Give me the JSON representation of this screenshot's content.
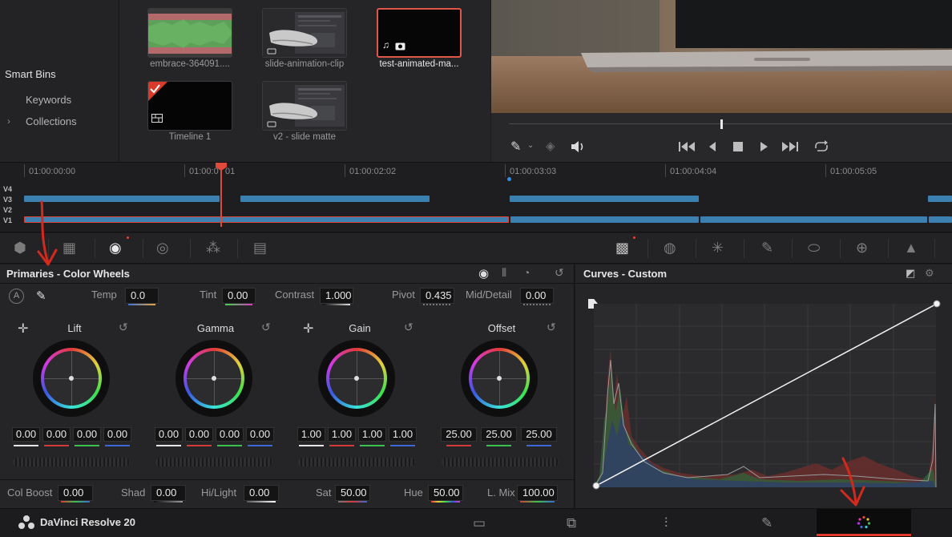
{
  "media_pool": {
    "smart_bins": "Smart Bins",
    "bin_items": [
      {
        "label": "Keywords"
      },
      {
        "label": "Collections"
      }
    ],
    "clips": [
      {
        "label": "embrace-364091....",
        "type": "audio"
      },
      {
        "label": "slide-animation-clip",
        "type": "video"
      },
      {
        "label": "test-animated-ma...",
        "type": "audio-video",
        "selected": true
      },
      {
        "label": "Timeline 1",
        "type": "timeline"
      },
      {
        "label": "v2 - slide matte",
        "type": "video"
      }
    ]
  },
  "viewer": {
    "icons": [
      "eyedropper-icon",
      "layers-icon",
      "volume-icon",
      "skip-start-icon",
      "step-back-icon",
      "stop-icon",
      "play-icon",
      "skip-end-icon",
      "loop-icon"
    ]
  },
  "timeline": {
    "timecodes": [
      "01:00:00:00",
      "01:00:0",
      "01",
      "01:00:02:02",
      "01:00:03:03",
      "01:00:04:04",
      "01:00:05:05"
    ],
    "tracks": [
      "V4",
      "V3",
      "V2",
      "V1"
    ]
  },
  "primaries": {
    "title": "Primaries - Color Wheels",
    "params_top": [
      {
        "label": "Temp",
        "value": "0.0"
      },
      {
        "label": "Tint",
        "value": "0.00"
      },
      {
        "label": "Contrast",
        "value": "1.000"
      },
      {
        "label": "Pivot",
        "value": "0.435"
      },
      {
        "label": "Mid/Detail",
        "value": "0.00"
      }
    ],
    "wheels": [
      {
        "title": "Lift",
        "values": [
          "0.00",
          "0.00",
          "0.00",
          "0.00"
        ]
      },
      {
        "title": "Gamma",
        "values": [
          "0.00",
          "0.00",
          "0.00",
          "0.00"
        ]
      },
      {
        "title": "Gain",
        "values": [
          "1.00",
          "1.00",
          "1.00",
          "1.00"
        ]
      },
      {
        "title": "Offset",
        "values": [
          "25.00",
          "25.00",
          "25.00"
        ]
      }
    ],
    "params_bottom": [
      {
        "label": "Col Boost",
        "value": "0.00"
      },
      {
        "label": "Shad",
        "value": "0.00"
      },
      {
        "label": "Hi/Light",
        "value": "0.00"
      },
      {
        "label": "Sat",
        "value": "50.00"
      },
      {
        "label": "Hue",
        "value": "50.00"
      },
      {
        "label": "L. Mix",
        "value": "100.00"
      }
    ],
    "auto_label": "A"
  },
  "curves": {
    "title": "Curves - Custom"
  },
  "bottom_bar": {
    "brand": "DaVinci Resolve 20",
    "pages": [
      "media-page-icon",
      "edit-page-icon",
      "fairlight-page-icon",
      "fusion-page-icon",
      "color-page-icon"
    ],
    "active_page": "color-page-icon"
  },
  "colors": {
    "accent_red": "#e03a2a",
    "clip_blue": "#3c7fb1",
    "playhead": "#e04a3a"
  }
}
